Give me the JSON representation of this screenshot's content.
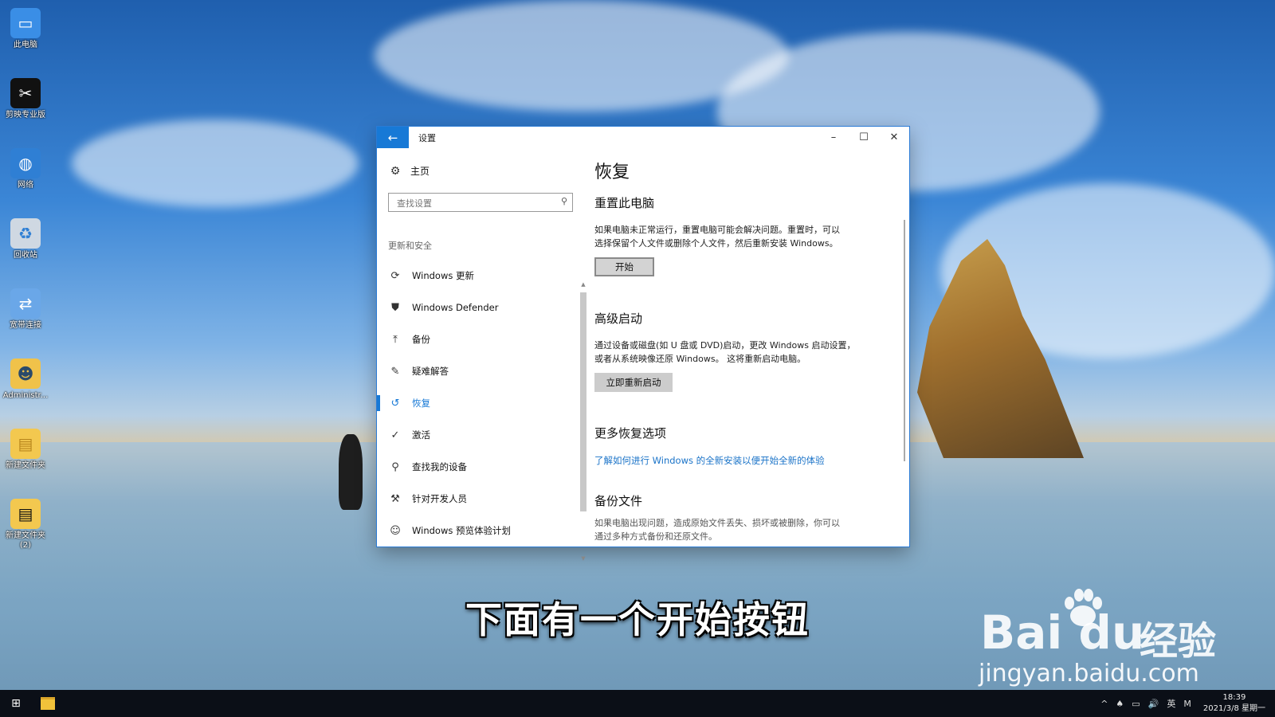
{
  "desktop": {
    "icons": [
      {
        "label": "此电脑",
        "icon": "computer-icon"
      },
      {
        "label": "剪映专业版",
        "icon": "capcut-icon"
      },
      {
        "label": "网络",
        "icon": "network-icon"
      },
      {
        "label": "回收站",
        "icon": "recycle-bin-icon"
      },
      {
        "label": "宽带连接",
        "icon": "broadband-icon"
      },
      {
        "label": "Administr...",
        "icon": "user-folder-icon"
      },
      {
        "label": "新建文件夹",
        "icon": "folder-icon"
      },
      {
        "label": "新建文件夹 (2)",
        "icon": "folder-icon"
      }
    ]
  },
  "window": {
    "title": "设置",
    "back_icon": "back-arrow-icon",
    "controls": {
      "minimize": "–",
      "maximize": "☐",
      "close": "✕"
    }
  },
  "nav": {
    "home_label": "主页",
    "search_placeholder": "查找设置",
    "section_label": "更新和安全",
    "items": [
      {
        "label": "Windows 更新",
        "icon": "sync-icon",
        "glyph": "⟳"
      },
      {
        "label": "Windows Defender",
        "icon": "shield-icon",
        "glyph": "⛊"
      },
      {
        "label": "备份",
        "icon": "backup-arrow-icon",
        "glyph": "⤒"
      },
      {
        "label": "疑难解答",
        "icon": "wrench-icon",
        "glyph": "✎"
      },
      {
        "label": "恢复",
        "icon": "history-icon",
        "glyph": "↺"
      },
      {
        "label": "激活",
        "icon": "check-circle-icon",
        "glyph": "✓"
      },
      {
        "label": "查找我的设备",
        "icon": "find-device-icon",
        "glyph": "⚲"
      },
      {
        "label": "针对开发人员",
        "icon": "developer-tools-icon",
        "glyph": "⚒"
      },
      {
        "label": "Windows 预览体验计划",
        "icon": "insider-icon",
        "glyph": "☺"
      }
    ],
    "active_index": 4
  },
  "content": {
    "title": "恢复",
    "reset": {
      "heading": "重置此电脑",
      "line1": "如果电脑未正常运行，重置电脑可能会解决问题。重置时，可以",
      "line2": "选择保留个人文件或删除个人文件，然后重新安装 Windows。",
      "button": "开始"
    },
    "advanced": {
      "heading": "高级启动",
      "line1": "通过设备或磁盘(如 U 盘或 DVD)启动，更改 Windows 启动设置，",
      "line2": "或者从系统映像还原 Windows。 这将重新启动电脑。",
      "button": "立即重新启动"
    },
    "more": {
      "heading": "更多恢复选项",
      "link": "了解如何进行 Windows 的全新安装以便开始全新的体验"
    },
    "backup": {
      "heading": "备份文件",
      "line1": "如果电脑出现问题，造成原始文件丢失、损坏或被删除，你可以",
      "line2": "通过多种方式备份和还原文件。"
    }
  },
  "overlay": {
    "subtitle": "下面有一个开始按钮",
    "watermark_brand": "Bai du",
    "watermark_jingyan": "经验",
    "watermark_url": "jingyan.baidu.com"
  },
  "taskbar": {
    "tray": [
      "^",
      "♠",
      "▭",
      "🔊",
      "英",
      "M"
    ],
    "time": "18:39",
    "date": "2021/3/8 星期一"
  }
}
